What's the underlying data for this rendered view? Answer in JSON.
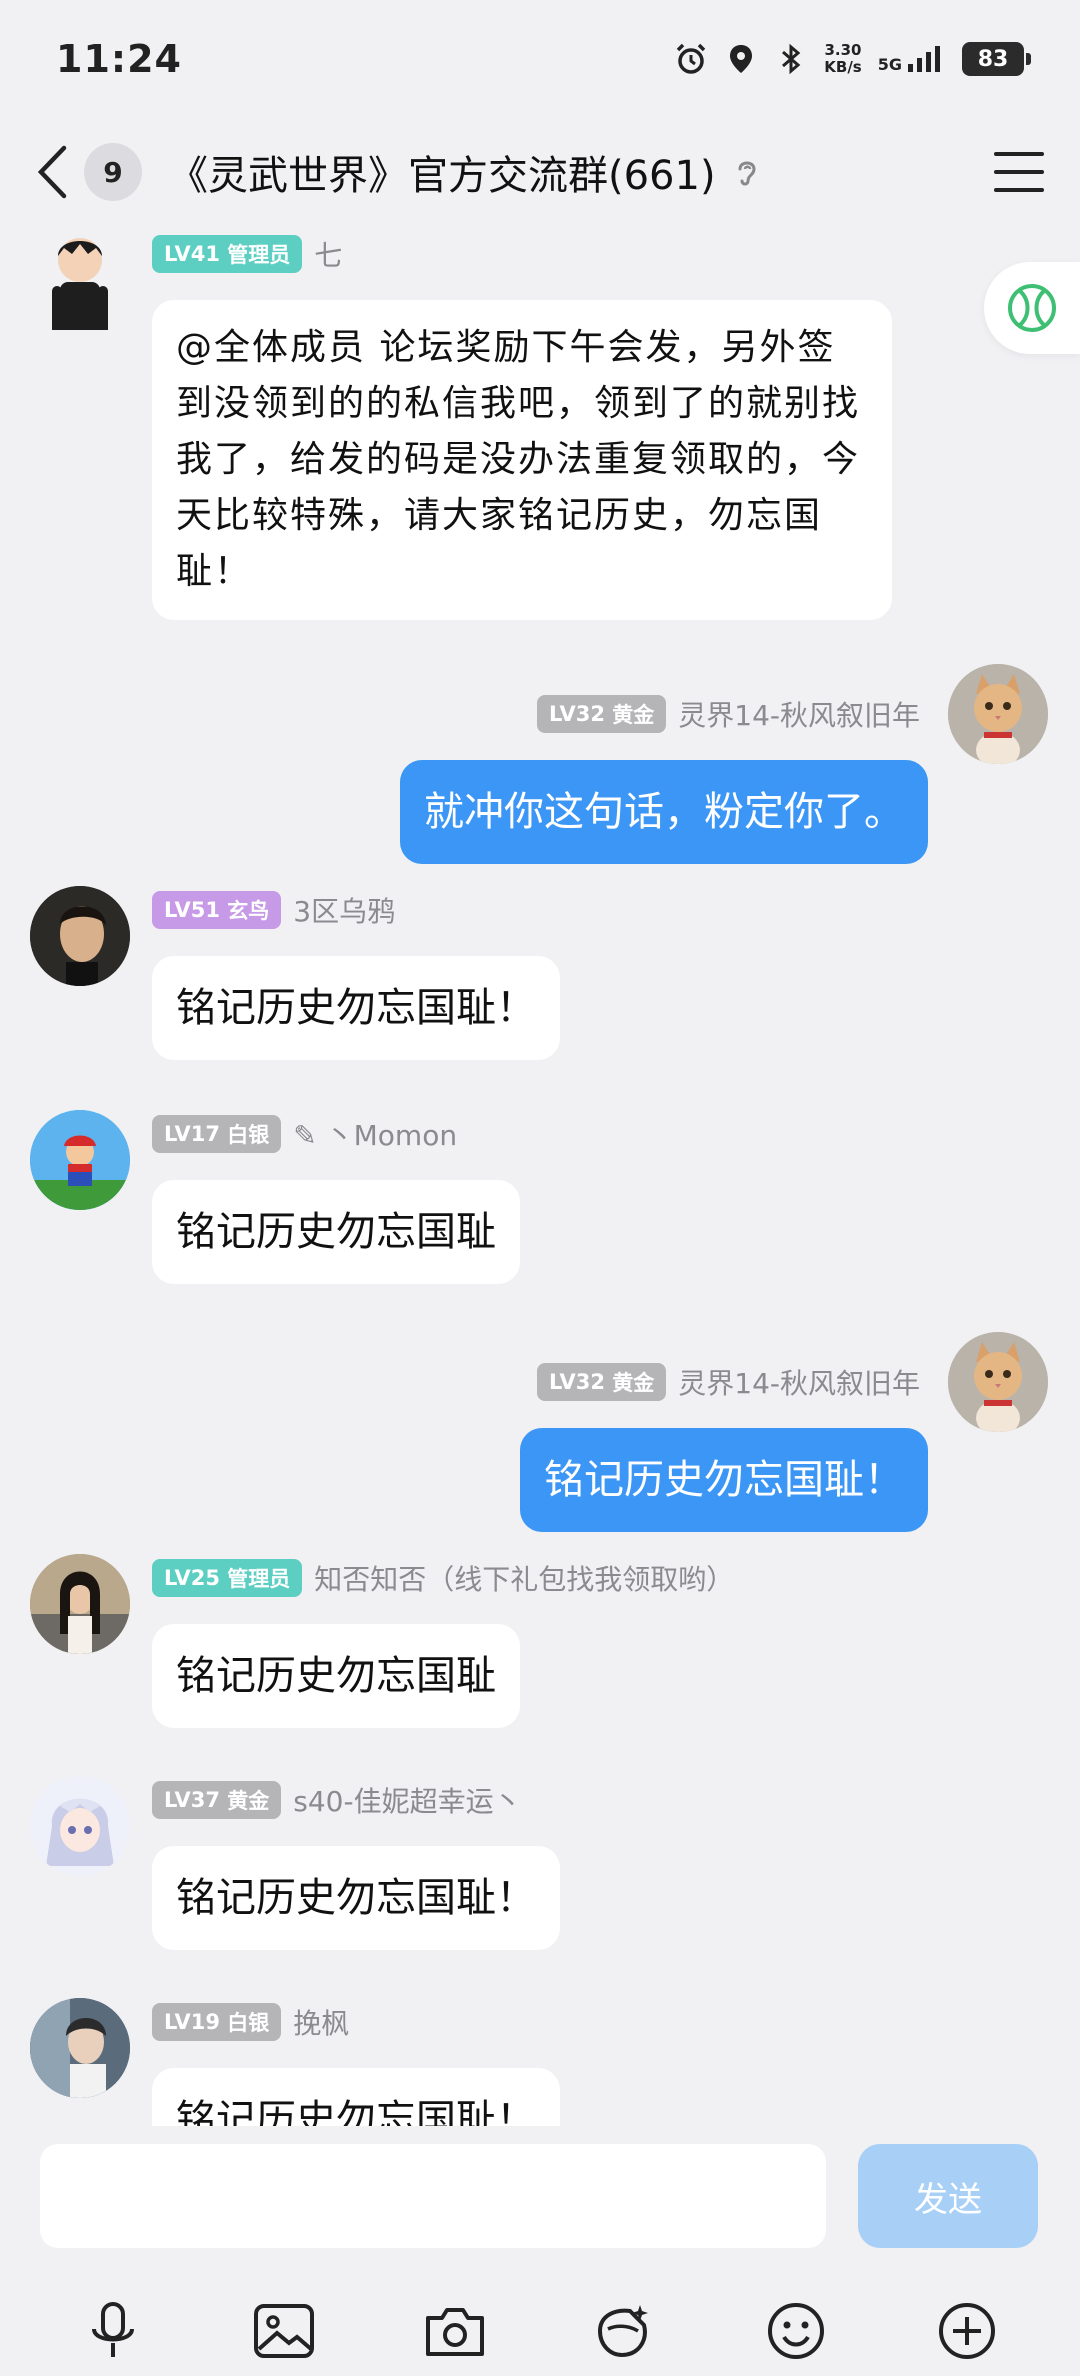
{
  "status_bar": {
    "time": "11:24",
    "net_speed_value": "3.30",
    "net_speed_unit": "KB/s",
    "network": "5G",
    "battery": "83"
  },
  "header": {
    "unread_count": "9",
    "title": "《灵武世界》官方交流群(661)"
  },
  "messages": [
    {
      "level": "LV41",
      "role": "管理员",
      "badge_color": "#5ccfc2",
      "nick": "七",
      "text": "@全体成员 论坛奖励下午会发，另外签到没领到的的私信我吧，领到了的就别找我了，给发的码是没办法重复领取的，今天比较特殊，请大家铭记历史，勿忘国耻！",
      "mine": false
    },
    {
      "level": "LV32",
      "role": "黄金",
      "badge_color": "#b5b5b8",
      "nick": "灵界14-秋风叙旧年",
      "text": "就冲你这句话，粉定你了。",
      "mine": true
    },
    {
      "level": "LV51",
      "role": "玄鸟",
      "badge_color": "#c79ae8",
      "nick": "3区乌鸦",
      "text": "铭记历史勿忘国耻！",
      "mine": false
    },
    {
      "level": "LV17",
      "role": "白银",
      "badge_color": "#b5b5b8",
      "nick": "✎ 丶Momon",
      "text": "铭记历史勿忘国耻",
      "mine": false
    },
    {
      "level": "LV32",
      "role": "黄金",
      "badge_color": "#b5b5b8",
      "nick": "灵界14-秋风叙旧年",
      "text": "铭记历史勿忘国耻！",
      "mine": true
    },
    {
      "level": "LV25",
      "role": "管理员",
      "badge_color": "#5ccfc2",
      "nick": "知否知否（线下礼包找我领取哟）",
      "text": "铭记历史勿忘国耻",
      "mine": false
    },
    {
      "level": "LV37",
      "role": "黄金",
      "badge_color": "#b5b5b8",
      "nick": "s40-佳妮超幸运丶",
      "text": "铭记历史勿忘国耻！",
      "mine": false
    },
    {
      "level": "LV19",
      "role": "白银",
      "badge_color": "#b5b5b8",
      "nick": "挽枫",
      "text": "铭记历史勿忘国耻！",
      "mine": false
    }
  ],
  "input": {
    "placeholder": "",
    "send_label": "发送"
  },
  "toolbar": {
    "icons": [
      "microphone-icon",
      "image-icon",
      "camera-icon",
      "sticker-icon",
      "emoji-icon",
      "plus-icon"
    ]
  },
  "colors": {
    "mine_bubble": "#3c96f6",
    "send_disabled": "#a8d0f7",
    "background": "#f1f1f4"
  }
}
